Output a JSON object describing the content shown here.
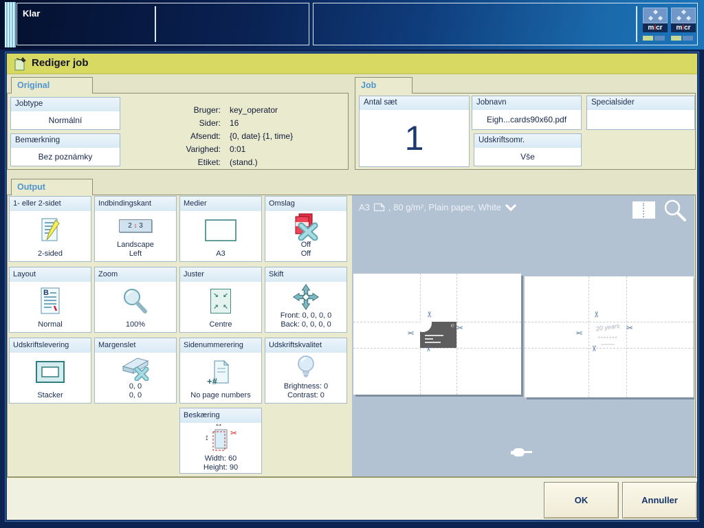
{
  "status_bar": {
    "status": "Klar",
    "micr": {
      "pre": "m",
      "i": "i",
      "post": "cr"
    }
  },
  "dialog": {
    "title": "Rediger job",
    "ok_label": "OK",
    "cancel_label": "Annuller"
  },
  "original": {
    "tab": "Original",
    "jobtype": {
      "label": "Jobtype",
      "value": "Normální"
    },
    "remark": {
      "label": "Bemærkning",
      "value": "Bez poznámky"
    },
    "info": {
      "rows": [
        {
          "label": "Bruger:",
          "value": "key_operator"
        },
        {
          "label": "Sider:",
          "value": "16"
        },
        {
          "label": "Afsendt:",
          "value": "{0, date} {1, time}"
        },
        {
          "label": "Varighed:",
          "value": "0:01"
        },
        {
          "label": "Etiket:",
          "value": "(stand.)"
        }
      ]
    }
  },
  "job": {
    "tab": "Job",
    "copies": {
      "label": "Antal sæt",
      "value": "1"
    },
    "jobname": {
      "label": "Jobnavn",
      "value": "Eigh...cards90x60.pdf"
    },
    "printrange": {
      "label": "Udskriftsomr.",
      "value": "Vše"
    },
    "specialpages": {
      "label": "Specialsider",
      "value": ""
    }
  },
  "output": {
    "tab": "Output",
    "tiles": [
      {
        "label": "1- eller 2-sidet",
        "value1": "2-sided",
        "value2": "",
        "icon": "duplex-icon"
      },
      {
        "label": "Indbindingskant",
        "value1": "Landscape",
        "value2": "Left",
        "icon": "binding-edge-icon",
        "icon_left": "2",
        "icon_right": "3"
      },
      {
        "label": "Medier",
        "value1": "A3",
        "value2": "",
        "icon": "media-icon"
      },
      {
        "label": "Omslag",
        "value1": "Off",
        "value2": "Off",
        "icon": "covers-off-icon"
      },
      {
        "label": "Layout",
        "value1": "Normal",
        "value2": "",
        "icon": "layout-icon",
        "icon_letter": "B"
      },
      {
        "label": "Zoom",
        "value1": "100%",
        "value2": "",
        "icon": "zoom-icon"
      },
      {
        "label": "Juster",
        "value1": "Centre",
        "value2": "",
        "icon": "align-centre-icon"
      },
      {
        "label": "Skift",
        "value1": "Front: 0, 0, 0, 0",
        "value2": "Back: 0, 0, 0, 0",
        "icon": "shift-icon"
      },
      {
        "label": "Udskriftslevering",
        "value1": "Stacker",
        "value2": "",
        "icon": "stacker-icon"
      },
      {
        "label": "Margenslet",
        "value1": "0, 0",
        "value2": "0, 0",
        "icon": "margin-erase-icon"
      },
      {
        "label": "Sidenummerering",
        "value1": "No page numbers",
        "value2": "",
        "icon": "page-numbers-icon",
        "icon_text": "+#"
      },
      {
        "label": "Udskriftskvalitet",
        "value1": "Brightness: 0",
        "value2": "Contrast: 0",
        "icon": "print-quality-icon"
      },
      {
        "label": "Beskæring",
        "value1": "Width: 60",
        "value2": "Height: 90",
        "icon": "trim-icon"
      }
    ]
  },
  "preview": {
    "media_size": "A3",
    "media_rest": ", 80 g/m², Plain paper, White",
    "back_card_text": "20 years"
  }
}
